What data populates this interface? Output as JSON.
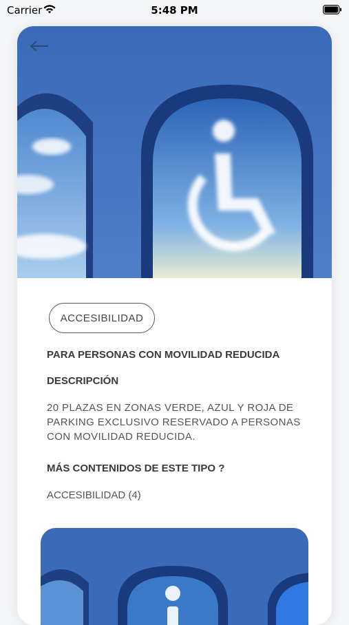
{
  "status_bar": {
    "carrier": "Carrier",
    "time": "5:48 PM"
  },
  "detail": {
    "back_icon": "arrow-left-icon",
    "hero_image": "wheelchair-cloud-arch-image",
    "category_tag": "ACCESIBILIDAD",
    "title": "PARA PERSONAS CON MOVILIDAD REDUCIDA",
    "description_heading": "DESCRIPCIÓN",
    "description_text": "20 PLAZAS EN ZONAS VERDE, AZUL Y ROJA DE PARKING EXCLUSIVO RESERVADO A PERSONAS CON MOVILIDAD REDUCIDA.",
    "more_heading": "MÁS CONTENIDOS DE ESTE TIPO ?",
    "more_link": "ACCESIBILIDAD (4)"
  },
  "related": {
    "image": "info-cloud-arch-image"
  },
  "colors": {
    "sky_dark": "#2f5fa8",
    "sky_light": "#6f9fd8",
    "accent_border": "#555555"
  }
}
